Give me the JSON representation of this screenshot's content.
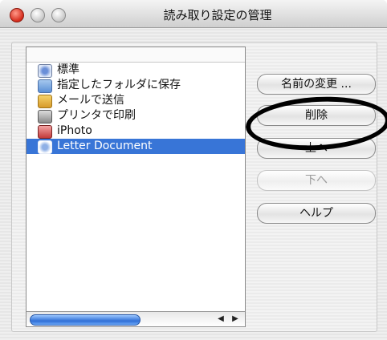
{
  "window": {
    "title": "読み取り設定の管理"
  },
  "list": {
    "items": [
      {
        "label": "標準",
        "icon": "profile-icon"
      },
      {
        "label": "指定したフォルダに保存",
        "icon": "folder-icon"
      },
      {
        "label": "メールで送信",
        "icon": "mail-icon"
      },
      {
        "label": "プリンタで印刷",
        "icon": "printer-icon"
      },
      {
        "label": "iPhoto",
        "icon": "iphoto-icon"
      },
      {
        "label": "Letter Document",
        "icon": "profile-icon",
        "selected": true
      }
    ]
  },
  "buttons": {
    "rename": "名前の変更 ...",
    "delete": "削除",
    "up": "上へ",
    "down": "下へ",
    "help": "ヘルプ"
  }
}
